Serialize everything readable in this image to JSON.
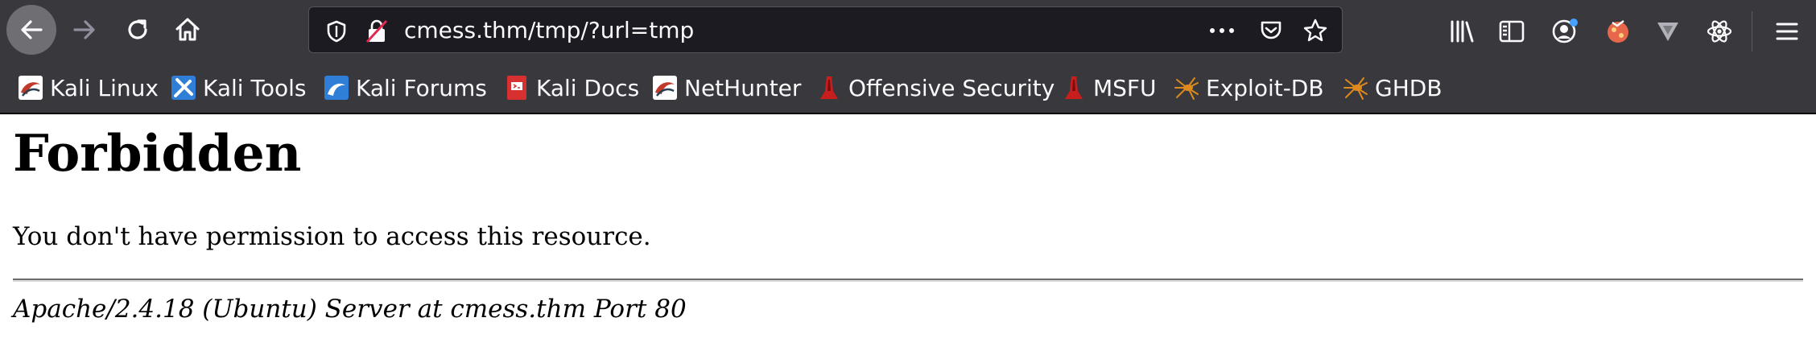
{
  "browser": {
    "url": "cmess.thm/tmp/?url=tmp",
    "bookmarks": [
      {
        "label": "Kali Linux",
        "icon": "kali-dragon-icon"
      },
      {
        "label": "Kali Tools",
        "icon": "kali-tools-icon"
      },
      {
        "label": "Kali Forums",
        "icon": "kali-forums-icon"
      },
      {
        "label": "Kali Docs",
        "icon": "kali-docs-icon"
      },
      {
        "label": "NetHunter",
        "icon": "nethunter-icon"
      },
      {
        "label": "Offensive Security",
        "icon": "offsec-icon"
      },
      {
        "label": "MSFU",
        "icon": "msfu-icon"
      },
      {
        "label": "Exploit-DB",
        "icon": "exploitdb-icon"
      },
      {
        "label": "GHDB",
        "icon": "ghdb-icon"
      }
    ],
    "colors": {
      "toolbar": "#38383d",
      "urlbar": "#1c1b22",
      "text": "#fbfbfe"
    }
  },
  "page": {
    "heading": "Forbidden",
    "message": "You don't have permission to access this resource.",
    "server_signature": "Apache/2.4.18 (Ubuntu) Server at cmess.thm Port 80"
  }
}
